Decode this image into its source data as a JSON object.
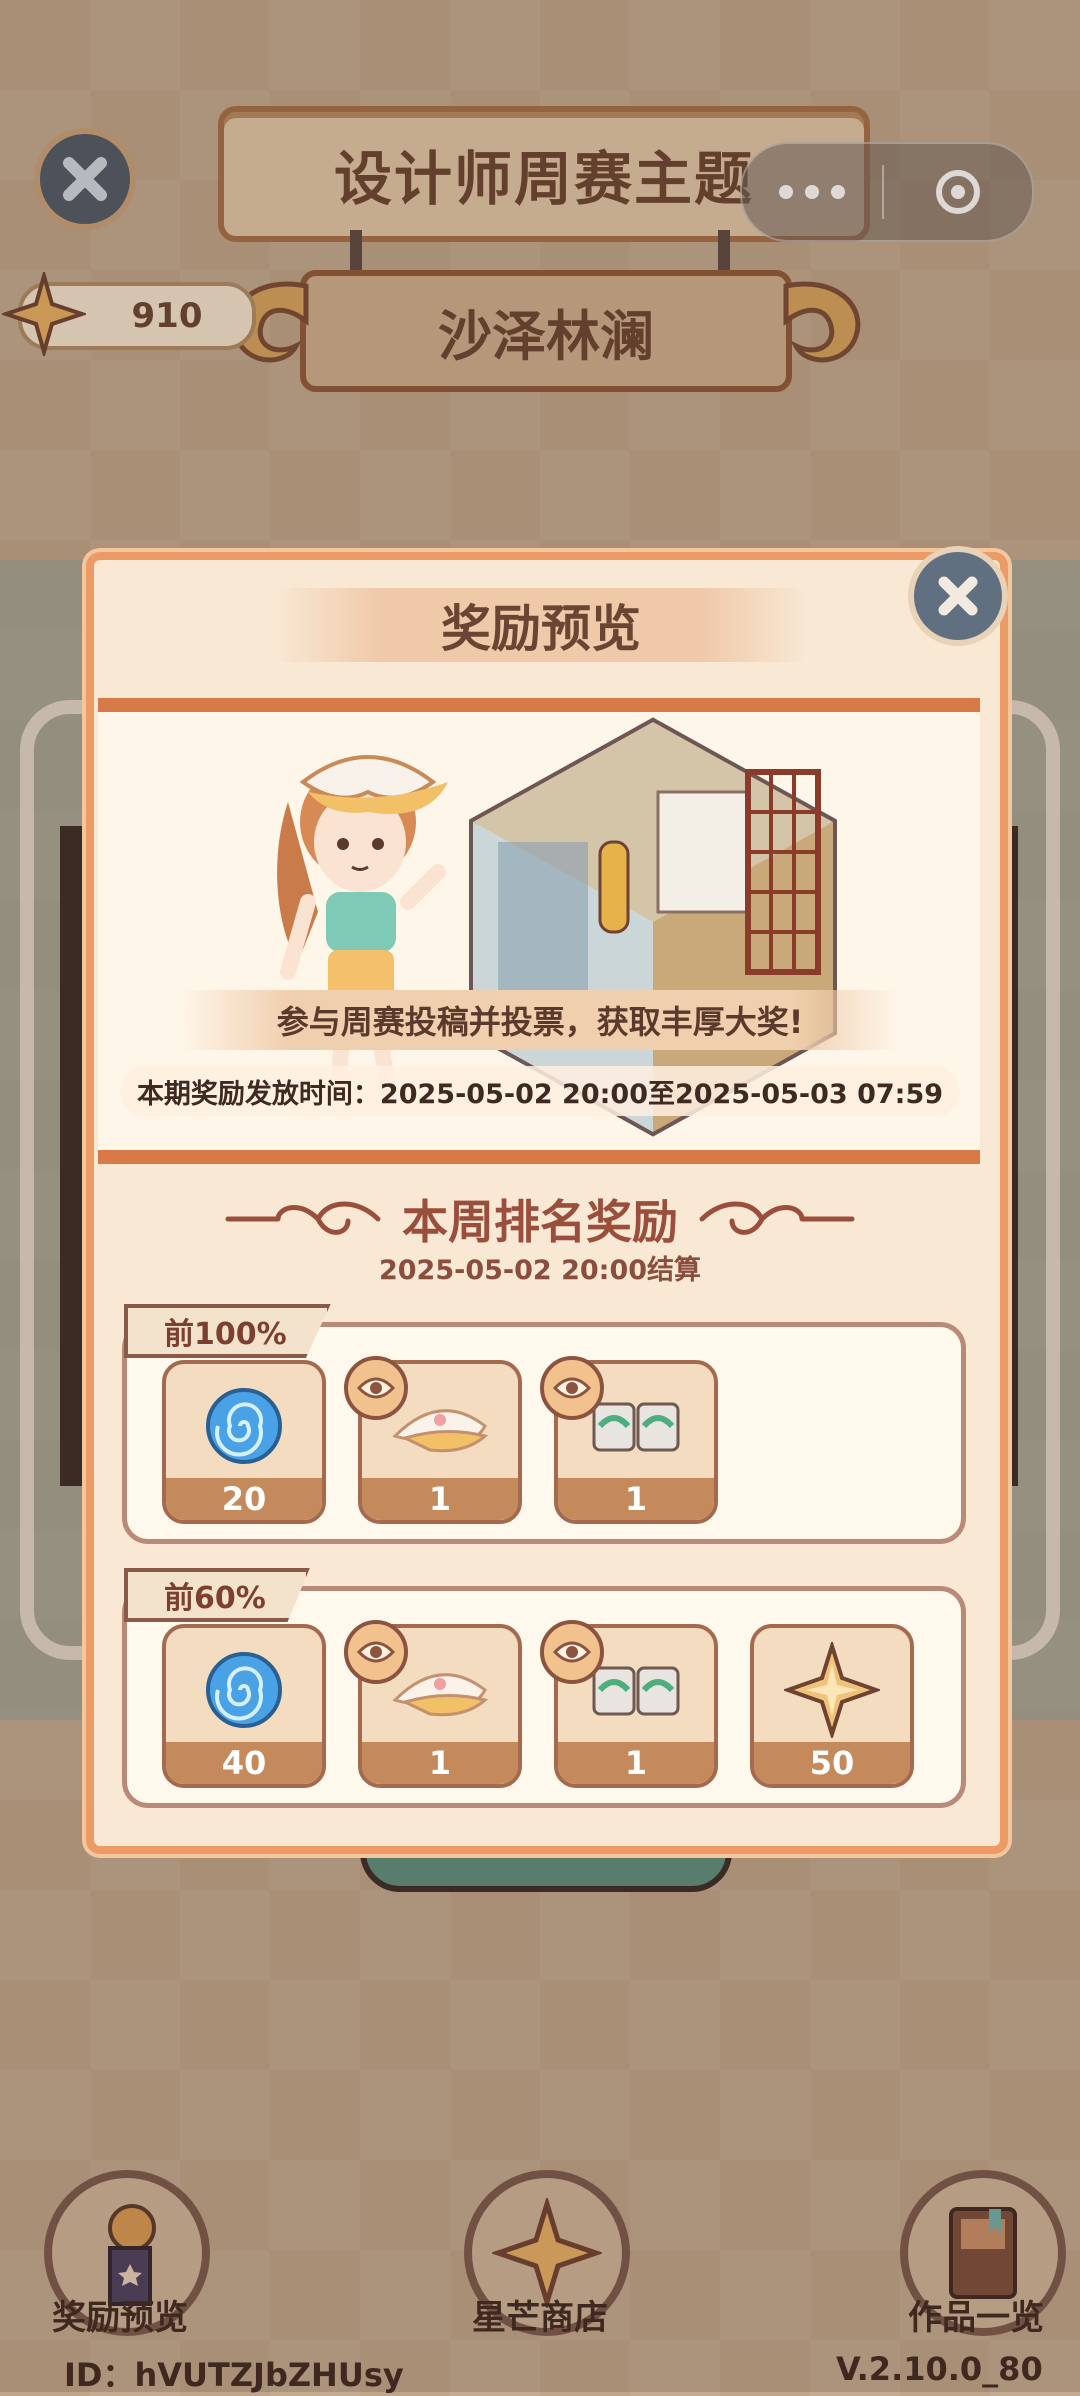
{
  "header": {
    "title": "设计师周赛主题",
    "theme_name": "沙泽林澜",
    "currency_value": "910"
  },
  "modal": {
    "title": "奖励预览",
    "banner_message": "参与周赛投稿并投票，获取丰厚大奖!",
    "banner_time": "本期奖励发放时间：2025-05-02 20:00至2025-05-03 07:59",
    "section_title": "本周排名奖励",
    "section_subtitle": "2025-05-02 20:00结算",
    "tiers": [
      {
        "label": "前100%",
        "items": [
          {
            "icon": "spiral-token-icon",
            "count": "20"
          },
          {
            "icon": "visor-hat-icon",
            "count": "1"
          },
          {
            "icon": "sticker-pack-icon",
            "count": "1"
          }
        ]
      },
      {
        "label": "前60%",
        "items": [
          {
            "icon": "spiral-token-icon",
            "count": "40"
          },
          {
            "icon": "visor-hat-icon",
            "count": "1"
          },
          {
            "icon": "sticker-pack-icon",
            "count": "1"
          },
          {
            "icon": "star-icon",
            "count": "50"
          }
        ]
      }
    ]
  },
  "nav": {
    "rewards_label": "奖励预览",
    "shop_label": "星芒商店",
    "works_label": "作品一览"
  },
  "footer": {
    "id_text": "ID：hVUTZJbZHUsy",
    "version_text": "V.2.10.0_80"
  },
  "colors": {
    "accent": "#ec9a66",
    "title_text": "#6b4534",
    "section_title": "#9a4f3c"
  }
}
